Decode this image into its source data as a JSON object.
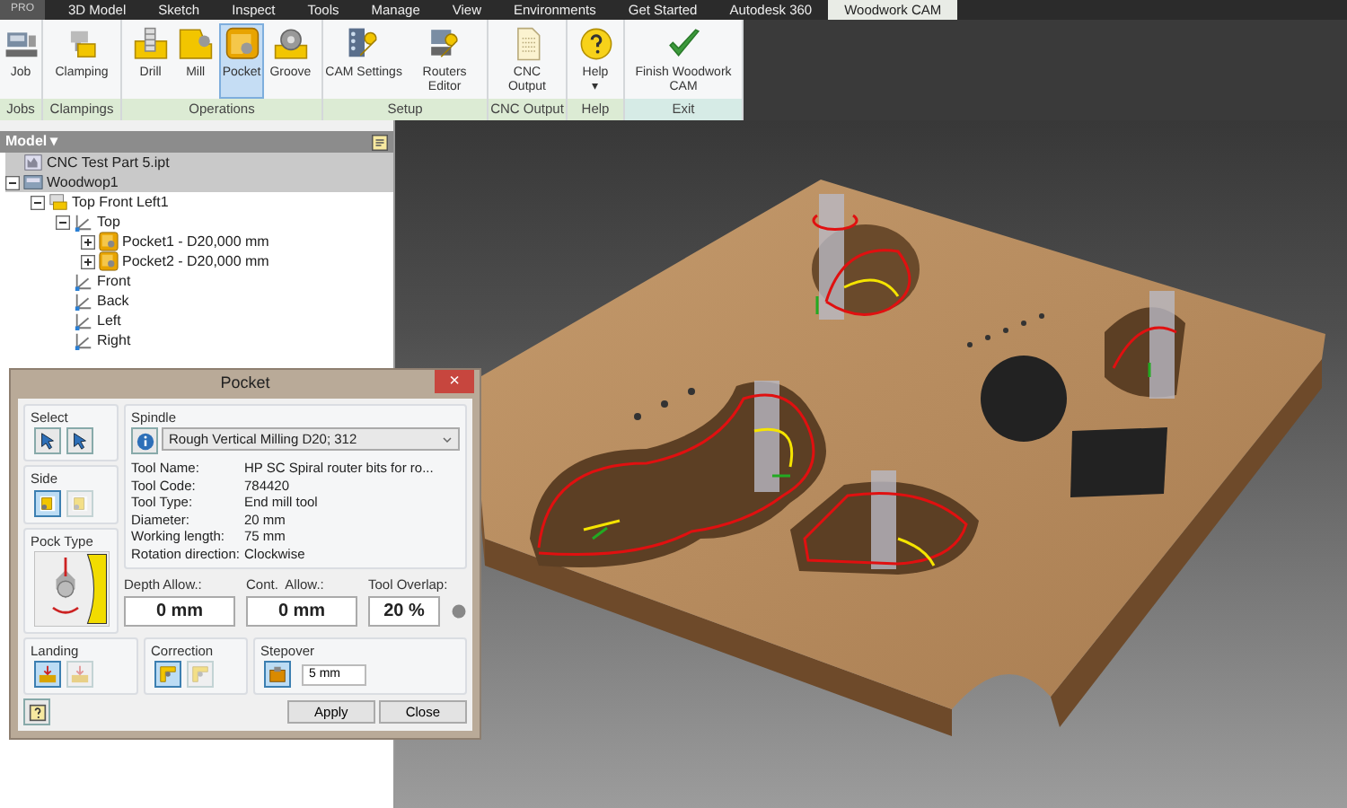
{
  "menu_tabs": [
    {
      "label": "PRO",
      "selected": false
    },
    {
      "label": "3D Model",
      "selected": false
    },
    {
      "label": "Sketch",
      "selected": false
    },
    {
      "label": "Inspect",
      "selected": false
    },
    {
      "label": "Tools",
      "selected": false
    },
    {
      "label": "Manage",
      "selected": false
    },
    {
      "label": "View",
      "selected": false
    },
    {
      "label": "Environments",
      "selected": false
    },
    {
      "label": "Get Started",
      "selected": false
    },
    {
      "label": "Autodesk 360",
      "selected": false
    },
    {
      "label": "Woodwork CAM",
      "selected": true
    }
  ],
  "ribbon_groups": [
    {
      "label": "Jobs",
      "buttons": [
        {
          "label": "Job",
          "selected": false
        }
      ]
    },
    {
      "label": "Clampings",
      "buttons": [
        {
          "label": "Clamping",
          "selected": false
        }
      ]
    },
    {
      "label": "Operations",
      "buttons": [
        {
          "label": "Drill",
          "selected": false
        },
        {
          "label": "Mill",
          "selected": false
        },
        {
          "label": "Pocket",
          "selected": true
        },
        {
          "label": "Groove",
          "selected": false
        }
      ]
    },
    {
      "label": "Setup",
      "buttons": [
        {
          "label": "CAM Settings",
          "selected": false
        },
        {
          "label": "Routers Editor",
          "selected": false
        }
      ]
    },
    {
      "label": "CNC Output",
      "buttons": [
        {
          "label": "CNC Output",
          "selected": false
        }
      ]
    },
    {
      "label": "Help",
      "buttons": [
        {
          "label": "Help",
          "selected": false,
          "caret": "▾"
        }
      ]
    },
    {
      "label": "Exit",
      "buttons": [
        {
          "label": "Finish Woodwork CAM",
          "selected": false
        }
      ]
    }
  ],
  "model_panel": {
    "title": "Model",
    "title_caret": "▾",
    "tree": [
      {
        "label": "CNC Test Part 5.ipt",
        "kind": "part",
        "selected": true
      },
      {
        "label": "Woodwop1",
        "kind": "machine",
        "selected": true,
        "expanded": true,
        "children": [
          {
            "label": "Top Front Left1",
            "kind": "setup",
            "selected": false,
            "expanded": true,
            "children": [
              {
                "label": "Top",
                "kind": "plane",
                "selected": false,
                "expanded": true,
                "children": [
                  {
                    "label": "Pocket1 - D20,000 mm",
                    "kind": "pocket",
                    "selected": false,
                    "expanded": false
                  },
                  {
                    "label": "Pocket2 - D20,000 mm",
                    "kind": "pocket",
                    "selected": false,
                    "expanded": false
                  }
                ]
              },
              {
                "label": "Front",
                "kind": "plane",
                "selected": false
              },
              {
                "label": "Back",
                "kind": "plane",
                "selected": false
              },
              {
                "label": "Left",
                "kind": "plane",
                "selected": false
              },
              {
                "label": "Right",
                "kind": "plane",
                "selected": false
              }
            ]
          }
        ]
      }
    ]
  },
  "dialog": {
    "title": "Pocket",
    "close_label": "×",
    "select": {
      "label": "Select",
      "options": [
        {
          "selected": false,
          "disabled": false
        },
        {
          "selected": false,
          "disabled": false
        }
      ]
    },
    "side": {
      "label": "Side",
      "options": [
        {
          "selected": true,
          "disabled": false
        },
        {
          "selected": false,
          "disabled": true
        }
      ]
    },
    "pock_type": {
      "label": "Pock Type"
    },
    "spindle": {
      "label": "Spindle",
      "value": "Rough Vertical Milling D20; 312",
      "properties": [
        {
          "label": "Tool Name:",
          "value": "HP SC Spiral router bits for ro..."
        },
        {
          "label": "Tool Code:",
          "value": "784420"
        },
        {
          "label": "Tool Type:",
          "value": "End mill tool"
        },
        {
          "label": "Diameter:",
          "value": "20 mm"
        },
        {
          "label": "Working length:",
          "value": "75 mm"
        },
        {
          "label": "Rotation direction:",
          "value": "Clockwise"
        }
      ]
    },
    "allowances": [
      {
        "label": "Depth Allow.:",
        "value": "0 mm"
      },
      {
        "label": "Cont.  Allow.:",
        "value": "0 mm"
      },
      {
        "label": "Tool Overlap:",
        "value": "20 %"
      }
    ],
    "landing": {
      "label": "Landing",
      "options": [
        {
          "selected": true,
          "disabled": false
        },
        {
          "selected": false,
          "disabled": true
        }
      ]
    },
    "correction": {
      "label": "Correction",
      "options": [
        {
          "selected": true,
          "disabled": false
        },
        {
          "selected": false,
          "disabled": true
        }
      ]
    },
    "stepover": {
      "label": "Stepover",
      "options": [
        {
          "selected": true,
          "disabled": false
        }
      ],
      "value": "5 mm"
    },
    "buttons": [
      "Apply",
      "Close"
    ]
  }
}
